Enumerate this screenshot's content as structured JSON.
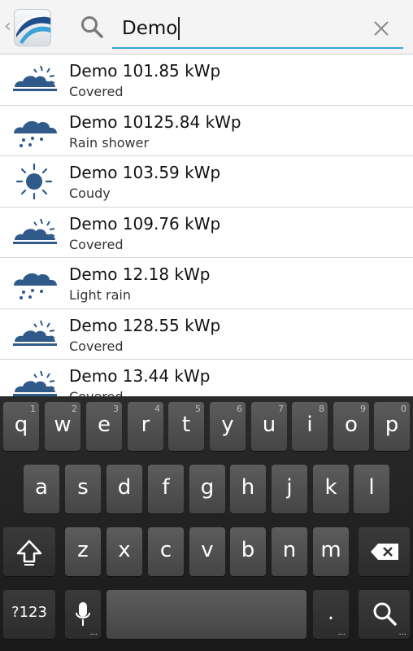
{
  "header": {
    "back_icon": "chevron-left-icon",
    "app_icon": "app-logo-icon",
    "search_icon": "search-icon",
    "query": "Demo",
    "clear_icon": "clear-icon"
  },
  "results": [
    {
      "title": "Demo 101.85 kWp",
      "subtitle": "Covered",
      "icon": "covered-cloud-sun-icon"
    },
    {
      "title": "Demo 10125.84 kWp",
      "subtitle": "Rain shower",
      "icon": "rain-cloud-icon"
    },
    {
      "title": "Demo 103.59 kWp",
      "subtitle": "Coudy",
      "icon": "sun-icon"
    },
    {
      "title": "Demo 109.76 kWp",
      "subtitle": "Covered",
      "icon": "covered-cloud-sun-icon"
    },
    {
      "title": "Demo 12.18 kWp",
      "subtitle": "Light rain",
      "icon": "rain-cloud-icon"
    },
    {
      "title": "Demo 128.55 kWp",
      "subtitle": "Covered",
      "icon": "covered-cloud-sun-icon"
    },
    {
      "title": "Demo 13.44 kWp",
      "subtitle": "Covered",
      "icon": "covered-cloud-sun-icon"
    }
  ],
  "keyboard": {
    "row1": [
      {
        "label": "q",
        "hint": "1"
      },
      {
        "label": "w",
        "hint": "2"
      },
      {
        "label": "e",
        "hint": "3"
      },
      {
        "label": "r",
        "hint": "4"
      },
      {
        "label": "t",
        "hint": "5"
      },
      {
        "label": "y",
        "hint": "6"
      },
      {
        "label": "u",
        "hint": "7"
      },
      {
        "label": "i",
        "hint": "8"
      },
      {
        "label": "o",
        "hint": "9"
      },
      {
        "label": "p",
        "hint": "0"
      }
    ],
    "row2": [
      "a",
      "s",
      "d",
      "f",
      "g",
      "h",
      "j",
      "k",
      "l"
    ],
    "row3": [
      "z",
      "x",
      "c",
      "v",
      "b",
      "n",
      "m"
    ],
    "symbols_label": "?123",
    "period_label": ".",
    "more_dots": "...",
    "icons": {
      "shift": "shift-icon",
      "backspace": "backspace-icon",
      "mic": "microphone-icon",
      "search": "search-icon"
    }
  },
  "colors": {
    "icon_blue": "#2f5a8a",
    "accent": "#3aa4d2"
  }
}
